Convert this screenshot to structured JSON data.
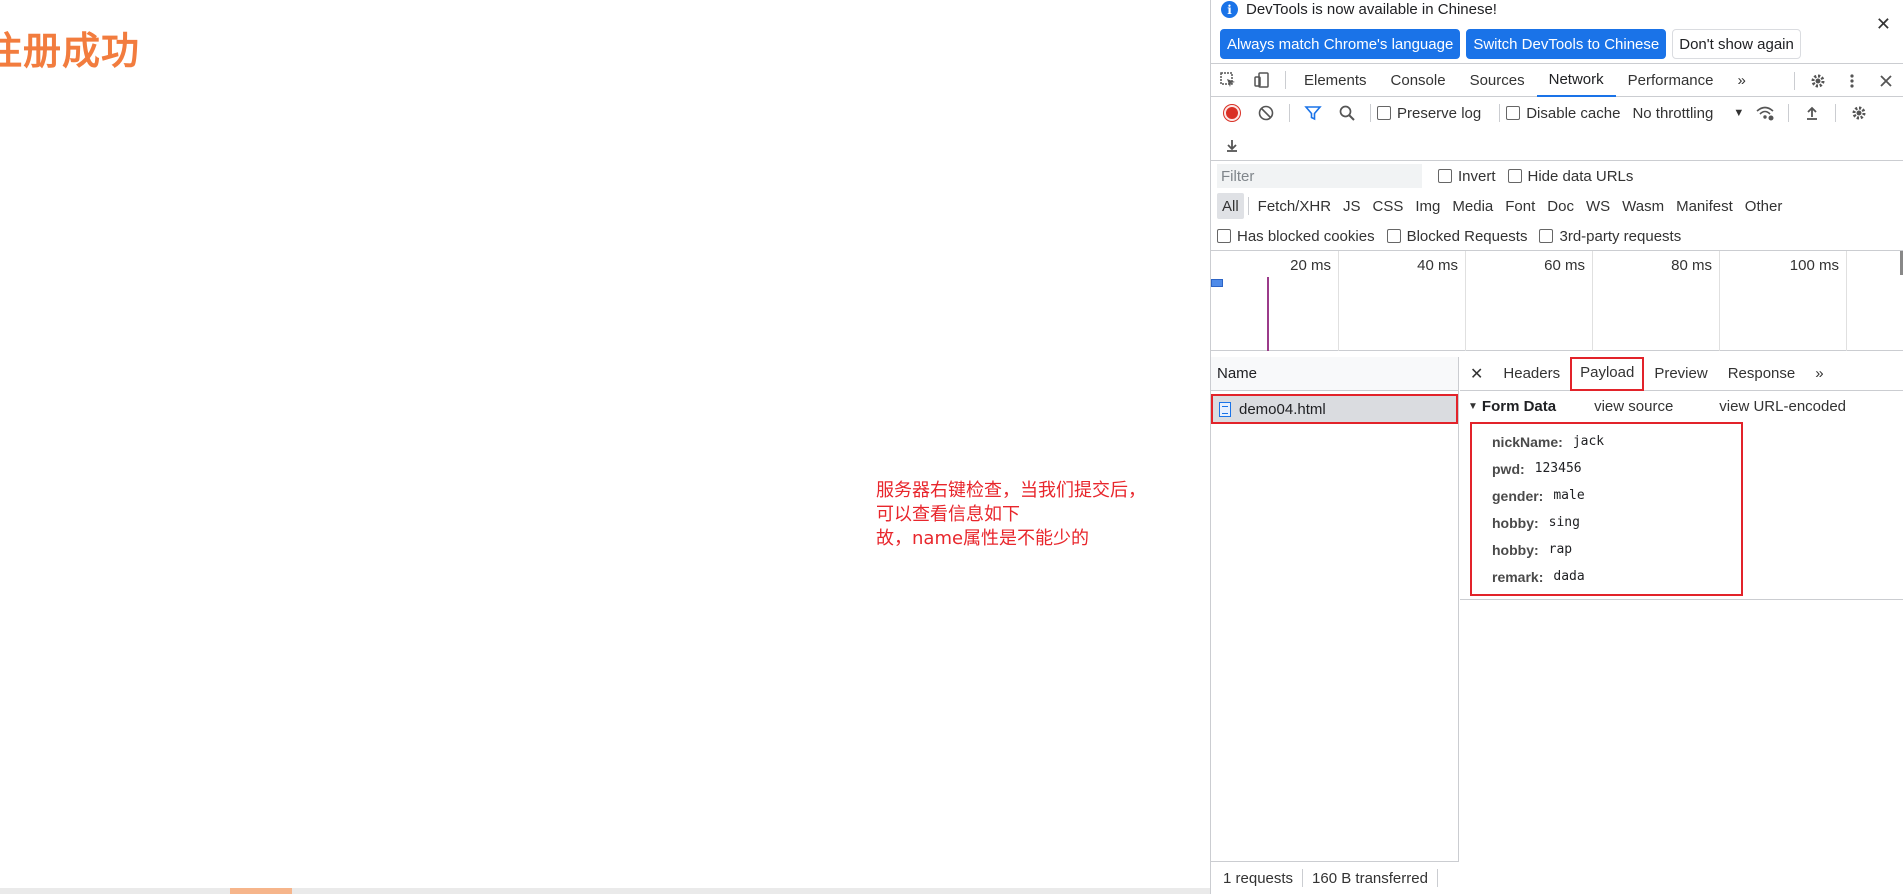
{
  "page": {
    "title": "注册成功",
    "note_lines": [
      "服务器右键检查，当我们提交后，",
      "可以查看信息如下",
      "故，name属性是不能少的"
    ]
  },
  "devtools": {
    "infobar": {
      "message": "DevTools is now available in Chinese!",
      "buttons": [
        "Always match Chrome's language",
        "Switch DevTools to Chinese",
        "Don't show again"
      ]
    },
    "tabs": [
      "Elements",
      "Console",
      "Sources",
      "Network",
      "Performance"
    ],
    "active_tab": "Network",
    "toolbar": {
      "preserve_log": "Preserve log",
      "disable_cache": "Disable cache",
      "throttling": "No throttling"
    },
    "filter": {
      "placeholder": "Filter",
      "invert": "Invert",
      "hide_data_urls": "Hide data URLs",
      "types": [
        "All",
        "Fetch/XHR",
        "JS",
        "CSS",
        "Img",
        "Media",
        "Font",
        "Doc",
        "WS",
        "Wasm",
        "Manifest",
        "Other"
      ],
      "blocked_cookies": "Has blocked cookies",
      "blocked_requests": "Blocked Requests",
      "third_party": "3rd-party requests"
    },
    "overview_ticks": [
      "20 ms",
      "40 ms",
      "60 ms",
      "80 ms",
      "100 ms"
    ],
    "requests": {
      "column_name": "Name",
      "items": [
        "demo04.html"
      ],
      "status": {
        "count": "1 requests",
        "transferred": "160 B transferred"
      }
    },
    "detail": {
      "tabs": [
        "Headers",
        "Payload",
        "Preview",
        "Response"
      ],
      "active_tab": "Payload",
      "form_title": "Form Data",
      "view_source": "view source",
      "view_url_encoded": "view URL-encoded",
      "fields": [
        {
          "key": "nickName:",
          "value": "jack"
        },
        {
          "key": "pwd:",
          "value": "123456"
        },
        {
          "key": "gender:",
          "value": "male"
        },
        {
          "key": "hobby:",
          "value": "sing"
        },
        {
          "key": "hobby:",
          "value": "rap"
        },
        {
          "key": "remark:",
          "value": "dada"
        }
      ]
    }
  },
  "colors": {
    "title": "#f27c3e",
    "note": "#e8262c",
    "accent": "#1a73e8",
    "highlight_box": "#e2232a"
  }
}
